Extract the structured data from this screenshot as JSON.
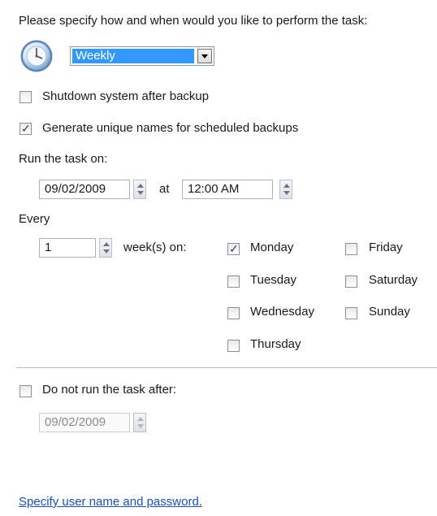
{
  "header": {
    "prompt": "Please specify how and when would you like to perform the task:"
  },
  "schedule": {
    "frequency": "Weekly"
  },
  "options": {
    "shutdown_label": "Shutdown system after backup",
    "shutdown_checked": false,
    "unique_names_label": "Generate unique names for scheduled backups",
    "unique_names_checked": true
  },
  "run_on": {
    "label": "Run the task on:",
    "date": "09/02/2009",
    "at_label": "at",
    "time": "12:00 AM"
  },
  "every": {
    "label": "Every",
    "value": "1",
    "unit_label": "week(s) on:",
    "days": [
      {
        "label": "Monday",
        "checked": true
      },
      {
        "label": "Tuesday",
        "checked": false
      },
      {
        "label": "Wednesday",
        "checked": false
      },
      {
        "label": "Thursday",
        "checked": false
      },
      {
        "label": "Friday",
        "checked": false
      },
      {
        "label": "Saturday",
        "checked": false
      },
      {
        "label": "Sunday",
        "checked": false
      }
    ]
  },
  "end": {
    "label": "Do not run the task after:",
    "checked": false,
    "date": "09/02/2009"
  },
  "footer": {
    "link": "Specify user name and password."
  },
  "colors": {
    "selection": "#3399ff",
    "link": "#1a4fbf",
    "separator": "#b7bcc2"
  },
  "icons": {
    "schedule": "clock-icon"
  }
}
